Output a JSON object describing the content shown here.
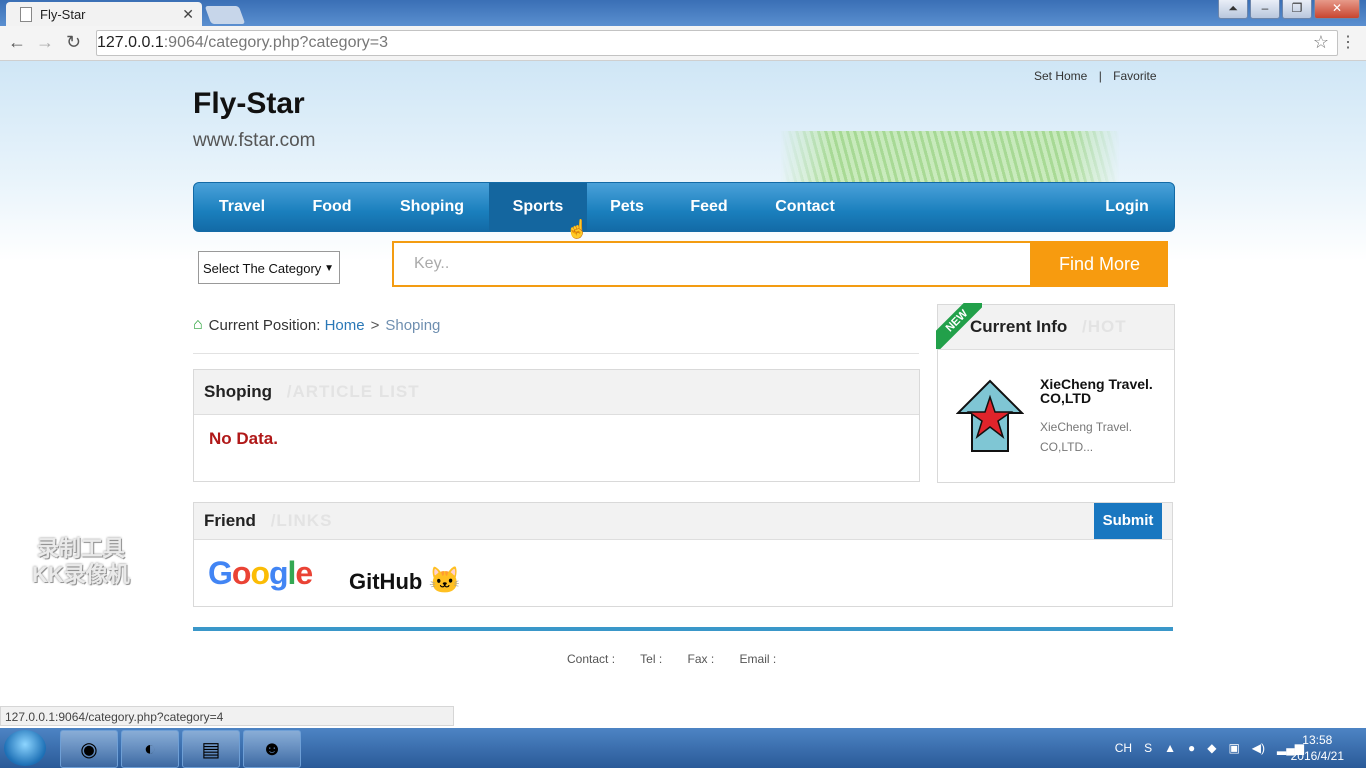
{
  "browser": {
    "tab_title": "Fly-Star",
    "url_host": "127.0.0.1",
    "url_rest": ":9064/category.php?category=3",
    "status_url": "127.0.0.1:9064/category.php?category=4"
  },
  "site": {
    "brand": "Fly-Star",
    "domain": "www.fstar.com",
    "toplinks": [
      "Set Home",
      "|",
      "Favorite"
    ]
  },
  "nav": {
    "items": [
      "Travel",
      "Food",
      "Shoping",
      "Sports",
      "Pets",
      "Feed",
      "Contact"
    ],
    "login": "Login"
  },
  "search": {
    "select_label": "Select The Category",
    "placeholder": "Key..",
    "button": "Find More"
  },
  "breadcrumb": {
    "label": "Current Position:",
    "home": "Home",
    "sep": ">",
    "current": "Shoping"
  },
  "list_panel": {
    "title": "Shoping",
    "subtitle": "/ARTICLE LIST",
    "empty": "No Data."
  },
  "info_panel": {
    "ribbon": "NEW",
    "title": "Current Info",
    "subtitle": "/HOT",
    "item_title": "XieCheng Travel. CO,LTD",
    "item_desc": "XieCheng Travel. CO,LTD..."
  },
  "friend_panel": {
    "title": "Friend",
    "subtitle": "/LINKS",
    "submit": "Submit",
    "links": [
      "Google",
      "GitHub"
    ]
  },
  "footer": {
    "items": [
      "Contact :",
      "Tel :",
      "Fax :",
      "Email :"
    ]
  },
  "watermark": {
    "line1": "录制工具",
    "line2": "KK录像机"
  },
  "taskbar": {
    "lang": "CH",
    "time": "13:58",
    "date": "2016/4/21"
  },
  "colors": {
    "nav_blue": "#1a7fbd",
    "search_orange": "#f79b0f",
    "nodata_red": "#b01818",
    "submit_blue": "#1977c0"
  }
}
